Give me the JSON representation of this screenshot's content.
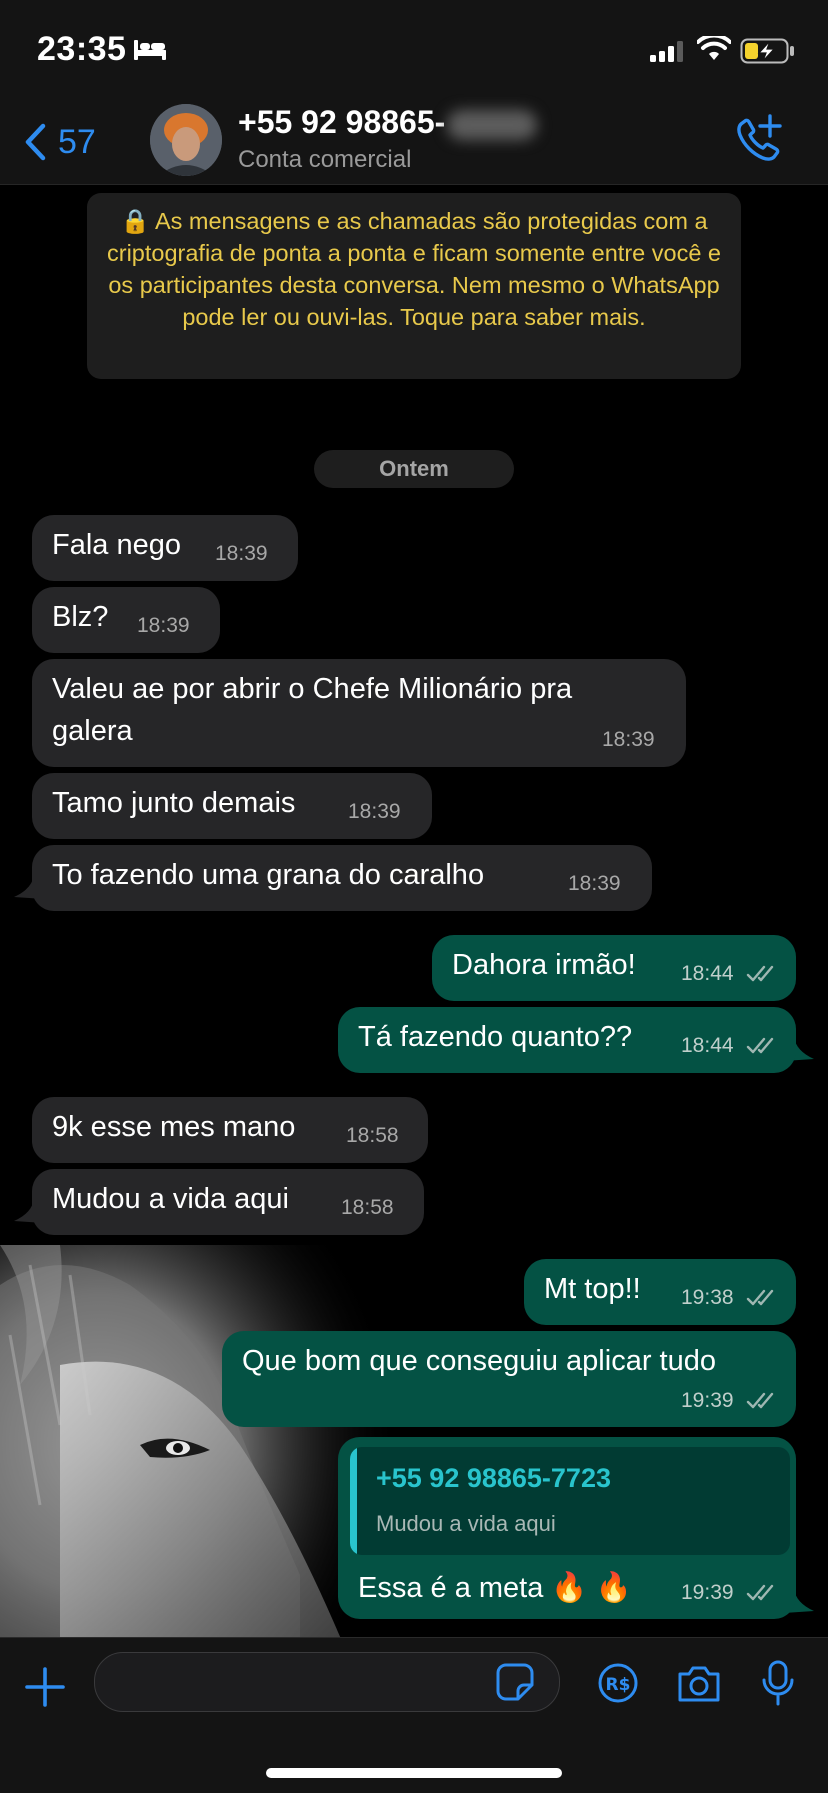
{
  "status_bar": {
    "time": "23:35",
    "icons": [
      "bed-icon",
      "signal-icon",
      "wifi-icon",
      "battery-charging-icon"
    ]
  },
  "header": {
    "back_count": "57",
    "contact_name": "+55 92 98865-",
    "subtitle": "Conta comercial",
    "call_icon": "add-call-icon"
  },
  "encryption_notice": "🔒 As mensagens e as chamadas são protegidas com a criptografia de ponta a ponta e ficam somente entre você e os participantes desta conversa. Nem mesmo o WhatsApp pode ler ou ouvi-las. Toque para saber mais.",
  "date_divider": "Ontem",
  "messages": [
    {
      "dir": "in",
      "text": "Fala nego",
      "time": "18:39"
    },
    {
      "dir": "in",
      "text": "Blz?",
      "time": "18:39"
    },
    {
      "dir": "in",
      "text_line1": "Valeu ae por abrir o Chefe Milionário pra",
      "text_line2": "galera",
      "time": "18:39"
    },
    {
      "dir": "in",
      "text": "Tamo junto demais",
      "time": "18:39"
    },
    {
      "dir": "in",
      "text": "To fazendo uma grana do caralho",
      "time": "18:39"
    },
    {
      "dir": "out",
      "text": "Dahora irmão!",
      "time": "18:44",
      "status": "read"
    },
    {
      "dir": "out",
      "text": "Tá fazendo quanto??",
      "time": "18:44",
      "status": "read"
    },
    {
      "dir": "in",
      "text": "9k esse mes mano",
      "time": "18:58"
    },
    {
      "dir": "in",
      "text": "Mudou a vida aqui",
      "time": "18:58"
    },
    {
      "dir": "out",
      "text": "Mt top!!",
      "time": "19:38",
      "status": "read"
    },
    {
      "dir": "out",
      "text": "Que bom que conseguiu aplicar tudo",
      "time": "19:39",
      "status": "read"
    },
    {
      "dir": "out",
      "text": "Essa é a meta 🔥 🔥",
      "time": "19:39",
      "status": "read",
      "quote": {
        "name": "+55 92 98865-7723",
        "text": "Mudou a vida aqui"
      }
    }
  ],
  "input_bar": {
    "icons": [
      "plus-icon",
      "sticker-icon",
      "pix-payment-icon",
      "camera-icon",
      "microphone-icon"
    ]
  },
  "colors": {
    "accent": "#2e8cf0",
    "incoming_bubble": "#262628",
    "outgoing_bubble": "#045244",
    "encryption_text": "#e8c94b",
    "quote_accent": "#29c4cd"
  }
}
